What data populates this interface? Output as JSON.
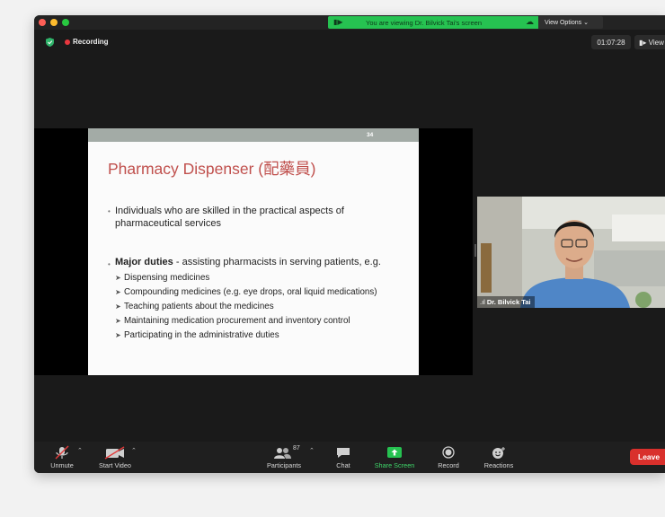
{
  "screen_share": {
    "banner_text": "You are viewing Dr. Bilvick Tai's screen",
    "view_options_label": "View Options"
  },
  "header": {
    "recording_label": "Recording",
    "timer": "01:07:28",
    "view_label": "View"
  },
  "slide": {
    "page_number": "34",
    "title": "Pharmacy Dispenser (配藥員)",
    "bullet1": "Individuals who are skilled in the practical aspects of pharmaceutical services",
    "bullet2_bold": "Major duties",
    "bullet2_rest": " - assisting pharmacists in serving patients, e.g.",
    "sub_items": [
      "Dispensing medicines",
      "Compounding medicines (e.g. eye drops, oral liquid medications)",
      "Teaching patients about the medicines",
      "Maintaining medication procurement and inventory control",
      "Participating in the administrative duties"
    ]
  },
  "video": {
    "participant_name": "Dr. Bilvick Tai"
  },
  "toolbar": {
    "unmute_label": "Unmute",
    "start_video_label": "Start Video",
    "participants_label": "Participants",
    "participants_count": "87",
    "chat_label": "Chat",
    "share_screen_label": "Share Screen",
    "record_label": "Record",
    "reactions_label": "Reactions",
    "leave_label": "Leave"
  },
  "colors": {
    "share_green": "#26c251",
    "slide_title_red": "#c0504d",
    "leave_red": "#d9302c",
    "recording_red": "#e8373e"
  }
}
